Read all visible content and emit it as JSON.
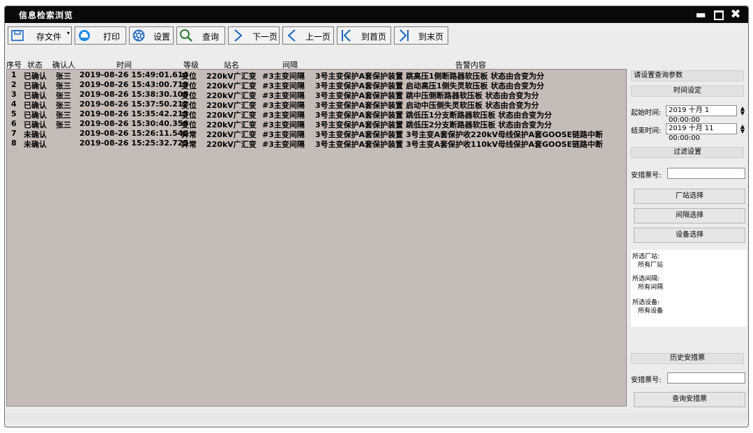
{
  "window": {
    "title": "信息检索浏览"
  },
  "toolbar": {
    "save": "存文件",
    "print": "打印",
    "settings": "设置",
    "query": "查询",
    "next": "下一页",
    "prev": "上一页",
    "first": "到首页",
    "last": "到末页"
  },
  "table": {
    "headers": {
      "no": "序号",
      "status": "状态",
      "confirmer": "确认人",
      "time": "时间",
      "level": "等级",
      "station": "站名",
      "bay": "间隔",
      "content": "告警内容"
    },
    "rows": [
      {
        "no": "1",
        "status": "已确认",
        "confirmer": "张三",
        "time": "2019-08-26 15:49:01.614",
        "level": "变位",
        "station": "220kV广汇变",
        "bay": "#3主变间隔",
        "content": "3号主变保护A套保护装置 跳高压1侧断路器软压板 状态由合变为分"
      },
      {
        "no": "2",
        "status": "已确认",
        "confirmer": "张三",
        "time": "2019-08-26 15:43:00.719",
        "level": "变位",
        "station": "220kV广汇变",
        "bay": "#3主变间隔",
        "content": "3号主变保护A套保护装置 启动高压1侧失灵软压板 状态由合变为分"
      },
      {
        "no": "3",
        "status": "已确认",
        "confirmer": "张三",
        "time": "2019-08-26 15:38:30.108",
        "level": "变位",
        "station": "220kV广汇变",
        "bay": "#3主变间隔",
        "content": "3号主变保护A套保护装置 跳中压侧断路器软压板 状态由合变为分"
      },
      {
        "no": "4",
        "status": "已确认",
        "confirmer": "张三",
        "time": "2019-08-26 15:37:50.212",
        "level": "变位",
        "station": "220kV广汇变",
        "bay": "#3主变间隔",
        "content": "3号主变保护A套保护装置 启动中压侧失灵软压板 状态由合变为分"
      },
      {
        "no": "5",
        "status": "已确认",
        "confirmer": "张三",
        "time": "2019-08-26 15:35:42.215",
        "level": "变位",
        "station": "220kV广汇变",
        "bay": "#3主变间隔",
        "content": "3号主变保护A套保护装置 跳低压1分支断路器软压板 状态由合变为分"
      },
      {
        "no": "6",
        "status": "已确认",
        "confirmer": "张三",
        "time": "2019-08-26 15:30:40.356",
        "level": "变位",
        "station": "220kV广汇变",
        "bay": "#3主变间隔",
        "content": "3号主变保护A套保护装置 跳低压2分支断路器软压板 状态由合变为分"
      },
      {
        "no": "7",
        "status": "未确认",
        "confirmer": "",
        "time": "2019-08-26 15:26:11.546",
        "level": "异常",
        "station": "220kV广汇变",
        "bay": "#3主变间隔",
        "content": "3号主变保护A套保护装置 3号主变A套保护收220kV母线保护A套GOOSE链路中断"
      },
      {
        "no": "8",
        "status": "未确认",
        "confirmer": "",
        "time": "2019-08-26 15:25:32.725",
        "level": "异常",
        "station": "220kV广汇变",
        "bay": "#3主变间隔",
        "content": "3号主变保护A套保护装置 3号主变A套保护收110kV母线保护A套GOOSE链路中断"
      }
    ]
  },
  "panel": {
    "header": "请设置查询参数",
    "time_section": "时间设定",
    "start_label": "起始时间:",
    "start_value": "2019 十月 1 00:00:00",
    "end_label": "结束时间:",
    "end_value": "2019 十月 11 00:00:00",
    "filter_section": "过滤设置",
    "ticket_label": "安措票号:",
    "station_btn": "厂站选择",
    "bay_btn": "间隔选择",
    "device_btn": "设备选择",
    "sel_station_label": "所选厂站:",
    "sel_station_value": "所有厂站",
    "sel_bay_label": "所选间隔:",
    "sel_bay_value": "所有间隔",
    "sel_device_label": "所选设备:",
    "sel_device_value": "所有设备",
    "history_section": "历史安措票",
    "history_ticket_label": "安措票号:",
    "query_ticket_btn": "查询安措票"
  }
}
